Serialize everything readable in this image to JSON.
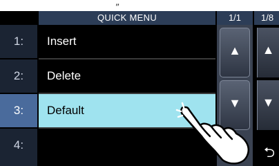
{
  "top_mark": "„",
  "menu": {
    "title": "QUICK MENU",
    "page": "1/1",
    "page_next": "1/8",
    "items": [
      {
        "num": "1:",
        "label": "Insert"
      },
      {
        "num": "2:",
        "label": "Delete"
      },
      {
        "num": "3:",
        "label": "Default"
      },
      {
        "num": "4:",
        "label": ""
      }
    ],
    "selected_index": 2
  },
  "colors": {
    "header": "#2c3d57",
    "selected_row": "#9fe3ef",
    "sidebar": "#3a4251",
    "selected_number": "#4a6b9c"
  },
  "icons": [
    "triangle-up-icon",
    "triangle-down-icon",
    "return-arrow-icon",
    "pointing-hand-icon"
  ]
}
